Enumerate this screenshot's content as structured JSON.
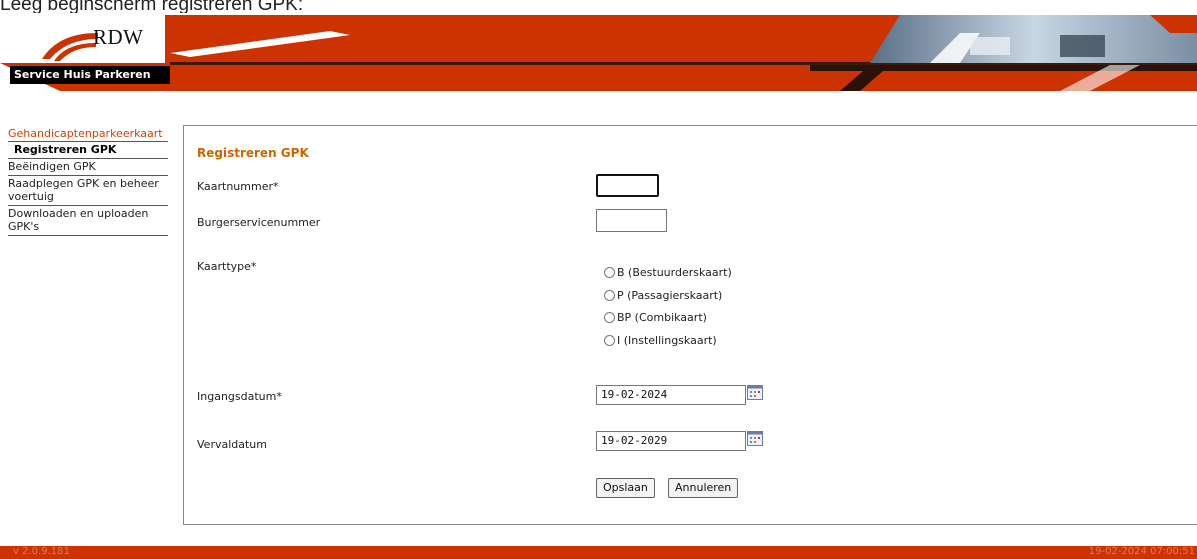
{
  "caption": "Leeg beginscherm registreren GPK:",
  "header": {
    "logo_text": "RDW",
    "service_title": "Service Huis Parkeren"
  },
  "sidebar": {
    "section_title": "Gehandicaptenparkeerkaart",
    "items": [
      {
        "label": "Registreren GPK",
        "active": true
      },
      {
        "label": "Beëindigen GPK",
        "active": false
      },
      {
        "label": "Raadplegen GPK en beheer voertuig",
        "active": false
      },
      {
        "label": "Downloaden en uploaden GPK's",
        "active": false
      }
    ]
  },
  "form": {
    "title": "Registreren GPK",
    "kaartnummer_label": "Kaartnummer*",
    "kaartnummer_value": "",
    "bsn_label": "Burgerservicenummer",
    "bsn_value": "",
    "kaarttype_label": "Kaarttype*",
    "kaarttype_options": [
      "B (Bestuurderskaart)",
      "P (Passagierskaart)",
      "BP (Combikaart)",
      "I (Instellingskaart)"
    ],
    "ingangsdatum_label": "Ingangsdatum*",
    "ingangsdatum_value": "19-02-2024",
    "vervaldatum_label": "Vervaldatum",
    "vervaldatum_value": "19-02-2029",
    "save_label": "Opslaan",
    "cancel_label": "Annuleren"
  },
  "footer": {
    "version": "v 2.0.9.181",
    "timestamp": "19-02-2024 07:00:51"
  },
  "colors": {
    "brand_red": "#cc3300",
    "title_orange": "#cc6600"
  }
}
